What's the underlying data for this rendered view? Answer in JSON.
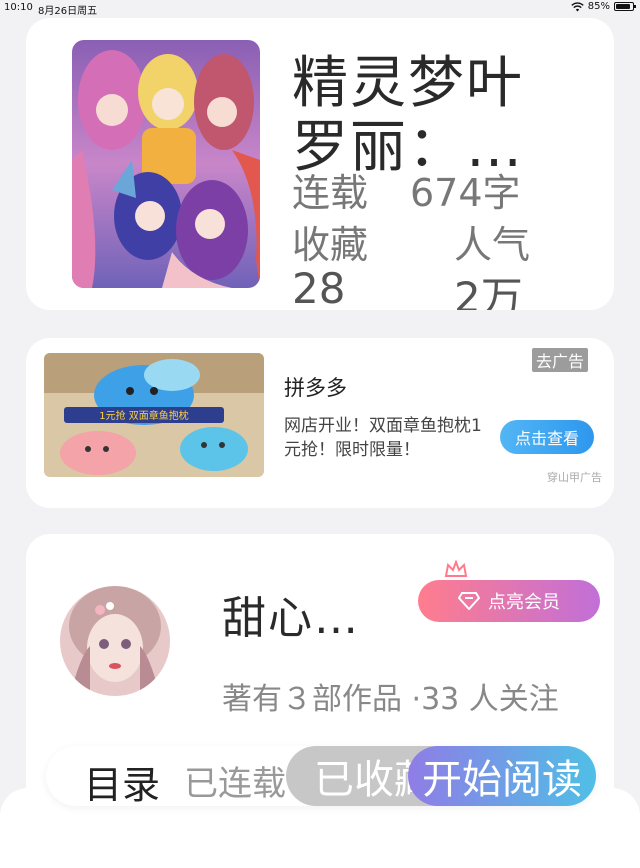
{
  "status_bar": {
    "time": "10:10",
    "date": "8月26日周五",
    "battery": "85%",
    "battery_level": 0.85
  },
  "book": {
    "title": "精灵梦叶罗丽：…",
    "serial_label": "连载",
    "word_count": "674字",
    "favorites_label": "收藏",
    "favorites_value": "28",
    "popularity_label": "人气",
    "popularity_value": "2万"
  },
  "ad": {
    "mark": "去广告",
    "source": "拼多多",
    "description": "网店开业！双面章鱼抱枕1元抢！限时限量！",
    "image_caption": "1元抢 双面章鱼抱枕",
    "cta": "点击查看",
    "network": "穿山甲广告"
  },
  "author": {
    "name": "甜心…",
    "vip_button": "点亮会员",
    "meta": "著有３部作品 ·33 人关注"
  },
  "bottom_bar": {
    "toc": "目录",
    "status": "已连载",
    "collected": "已收藏",
    "start_reading": "开始阅读"
  },
  "colors": {
    "accent_blue": "#2e97ee",
    "vip_gradient_start": "#ff7d8d",
    "vip_gradient_end": "#c16fd8",
    "read_gradient_start": "#8f7de6",
    "read_gradient_end": "#4fbfe6"
  }
}
